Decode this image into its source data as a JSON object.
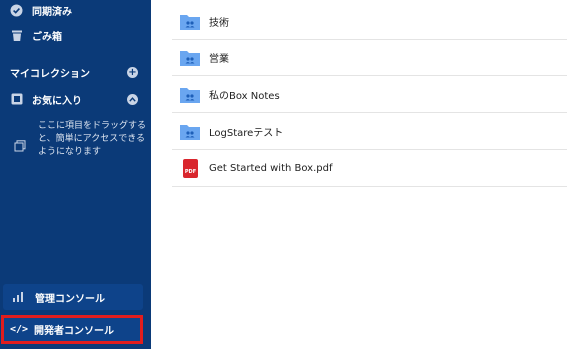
{
  "sidebar": {
    "synced_label": "同期済み",
    "trash_label": "ごみ箱",
    "my_collection_label": "マイコレクション",
    "favorites_label": "お気に入り",
    "favorites_hint": "ここに項目をドラッグすると、簡単にアクセスできるようになります",
    "admin_console_label": "管理コンソール",
    "dev_console_label": "開発者コンソール",
    "dev_console_icon_text": "</>"
  },
  "files": [
    {
      "name": "技術",
      "type": "folder",
      "icon": "shared-folder-icon"
    },
    {
      "name": "営業",
      "type": "folder",
      "icon": "shared-folder-icon"
    },
    {
      "name": "私のBox Notes",
      "type": "folder",
      "icon": "shared-folder-icon"
    },
    {
      "name": "LogStareテスト",
      "type": "folder",
      "icon": "shared-folder-icon"
    },
    {
      "name": "Get Started with Box.pdf",
      "type": "pdf",
      "icon": "pdf-icon",
      "badge": "PDF"
    }
  ],
  "colors": {
    "sidebar_bg": "#0b3a78",
    "folder_blue": "#6aa6f0",
    "pdf_red": "#d9262d",
    "highlight_red": "#e11d1d"
  }
}
